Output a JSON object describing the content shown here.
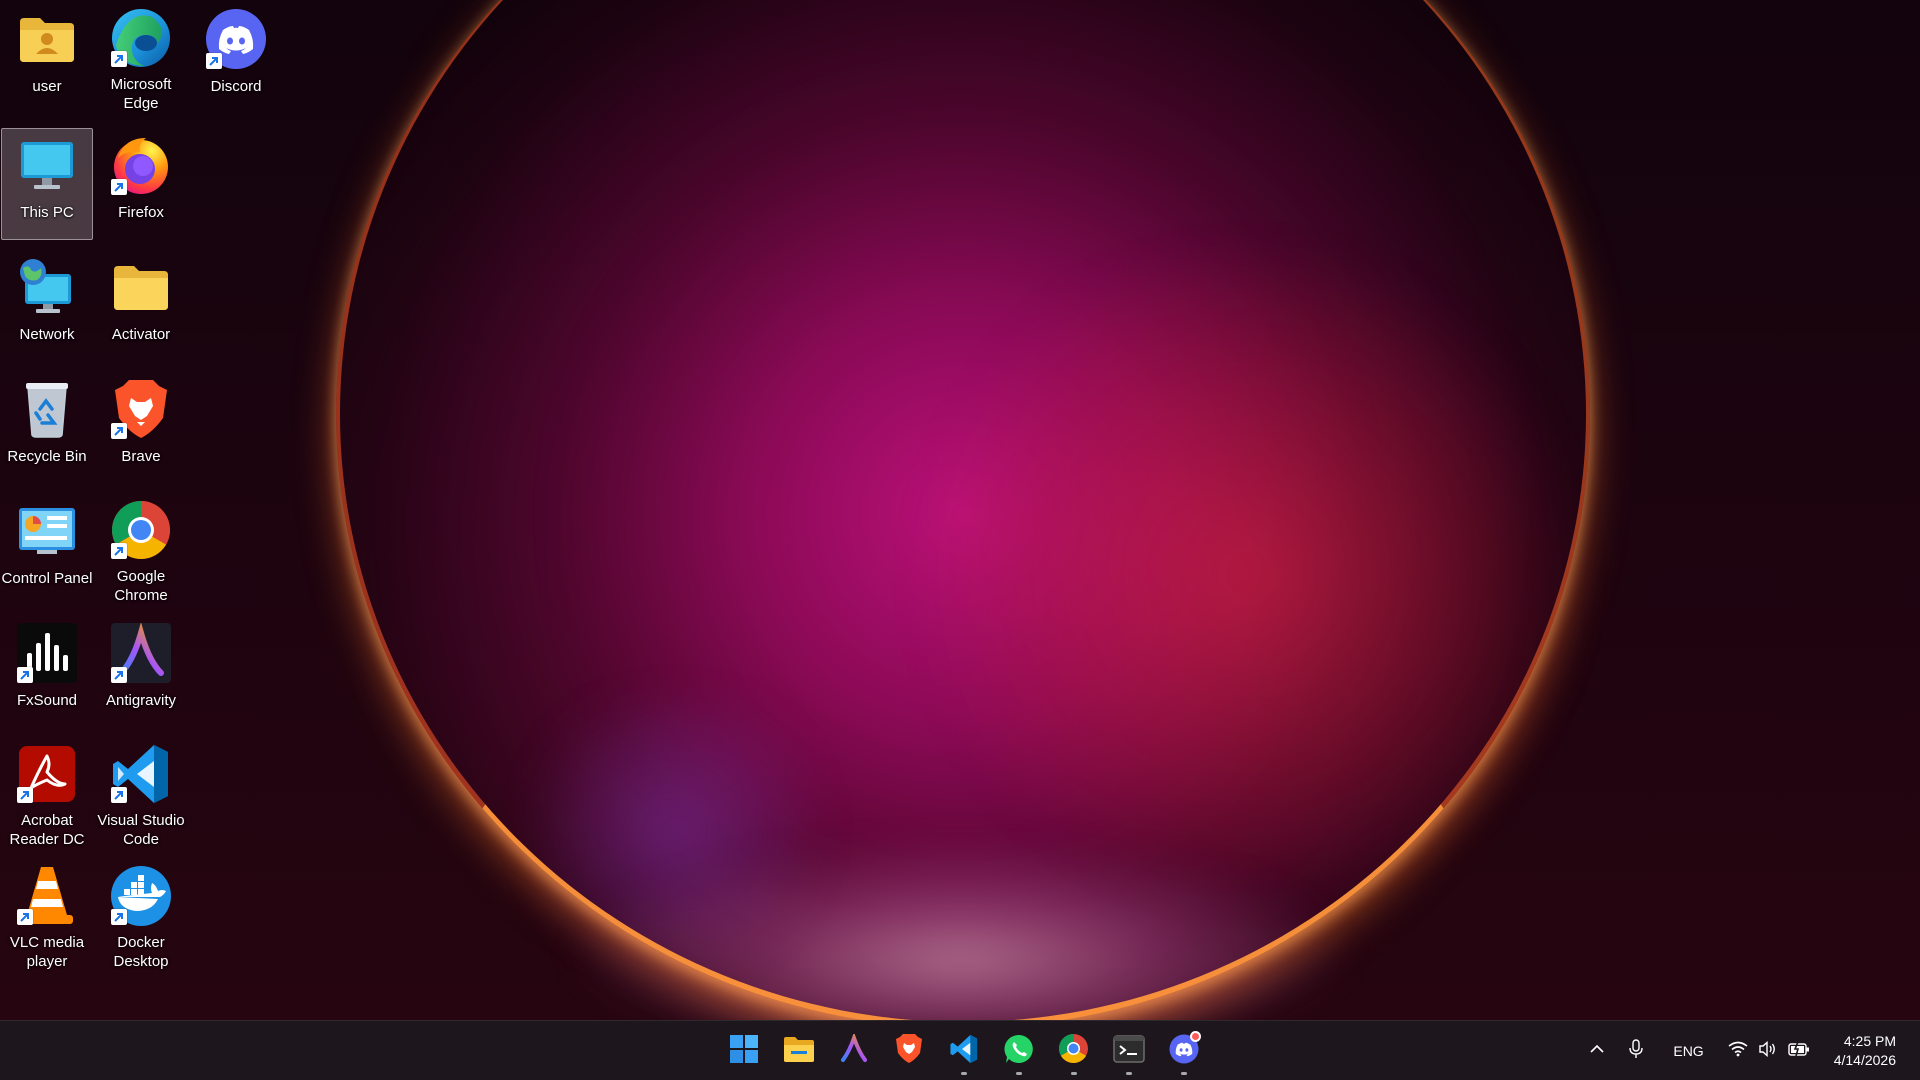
{
  "desktop": {
    "icons": [
      {
        "label": "user",
        "icon": "user-folder-icon",
        "shortcut": false
      },
      {
        "label": "Microsoft Edge",
        "icon": "edge-icon",
        "shortcut": true
      },
      {
        "label": "Discord",
        "icon": "discord-icon",
        "shortcut": true
      },
      {
        "label": "This PC",
        "icon": "monitor-icon",
        "shortcut": false,
        "selected": true
      },
      {
        "label": "Firefox",
        "icon": "firefox-icon",
        "shortcut": true
      },
      {
        "label": "Network",
        "icon": "network-icon",
        "shortcut": false
      },
      {
        "label": "Activator",
        "icon": "folder-icon",
        "shortcut": false
      },
      {
        "label": "Recycle Bin",
        "icon": "recycle-bin-icon",
        "shortcut": false
      },
      {
        "label": "Brave",
        "icon": "brave-icon",
        "shortcut": true
      },
      {
        "label": "Control Panel",
        "icon": "control-panel-icon",
        "shortcut": false
      },
      {
        "label": "Google Chrome",
        "icon": "chrome-icon",
        "shortcut": true
      },
      {
        "label": "FxSound",
        "icon": "fxsound-icon",
        "shortcut": true
      },
      {
        "label": "Antigravity",
        "icon": "antigravity-icon",
        "shortcut": true
      },
      {
        "label": "Acrobat Reader DC",
        "icon": "acrobat-icon",
        "shortcut": true
      },
      {
        "label": "Visual Studio Code",
        "icon": "vscode-icon",
        "shortcut": true
      },
      {
        "label": "VLC media player",
        "icon": "vlc-icon",
        "shortcut": true
      },
      {
        "label": "Docker Desktop",
        "icon": "docker-icon",
        "shortcut": true
      }
    ]
  },
  "taskbar": {
    "apps": [
      {
        "icon": "windows-start-icon",
        "running": false
      },
      {
        "icon": "file-explorer-icon",
        "running": false
      },
      {
        "icon": "antigravity-icon",
        "running": false
      },
      {
        "icon": "brave-icon",
        "running": false
      },
      {
        "icon": "vscode-icon",
        "running": true
      },
      {
        "icon": "whatsapp-icon",
        "running": true
      },
      {
        "icon": "chrome-icon",
        "running": true
      },
      {
        "icon": "terminal-icon",
        "running": true
      },
      {
        "icon": "discord-icon",
        "running": true,
        "badge": true
      }
    ],
    "tray": {
      "language": "ENG",
      "time": "4:25 PM",
      "date": "4/14/2026"
    }
  },
  "colors": {
    "taskbar_bg": "#1e181e",
    "selection": "#ffffff",
    "accent_wallpaper": "#d6148c"
  }
}
